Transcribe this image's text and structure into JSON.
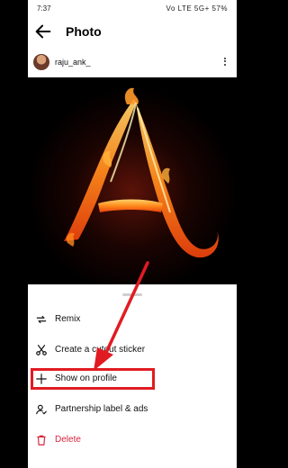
{
  "status_bar": {
    "time": "7:37",
    "icons_text": "Vo LTE 5G+ 57%"
  },
  "header": {
    "back_icon": "arrow-left-icon",
    "title": "Photo"
  },
  "post": {
    "username": "raju_ank_",
    "more_icon": "more-vertical-icon",
    "image_description_icon": "flaming-letter-image"
  },
  "menu": {
    "items": [
      {
        "label": "Remix",
        "icon": "remix-icon"
      },
      {
        "label": "Create a cutout sticker",
        "icon": "scissors-icon"
      },
      {
        "label": "Show on profile",
        "icon": "plus-icon"
      },
      {
        "label": "Partnership label & ads",
        "icon": "partnership-icon"
      },
      {
        "label": "Delete",
        "icon": "trash-icon"
      }
    ],
    "delete_color": "#d7263d"
  },
  "annotation": {
    "color": "#e11b22"
  }
}
